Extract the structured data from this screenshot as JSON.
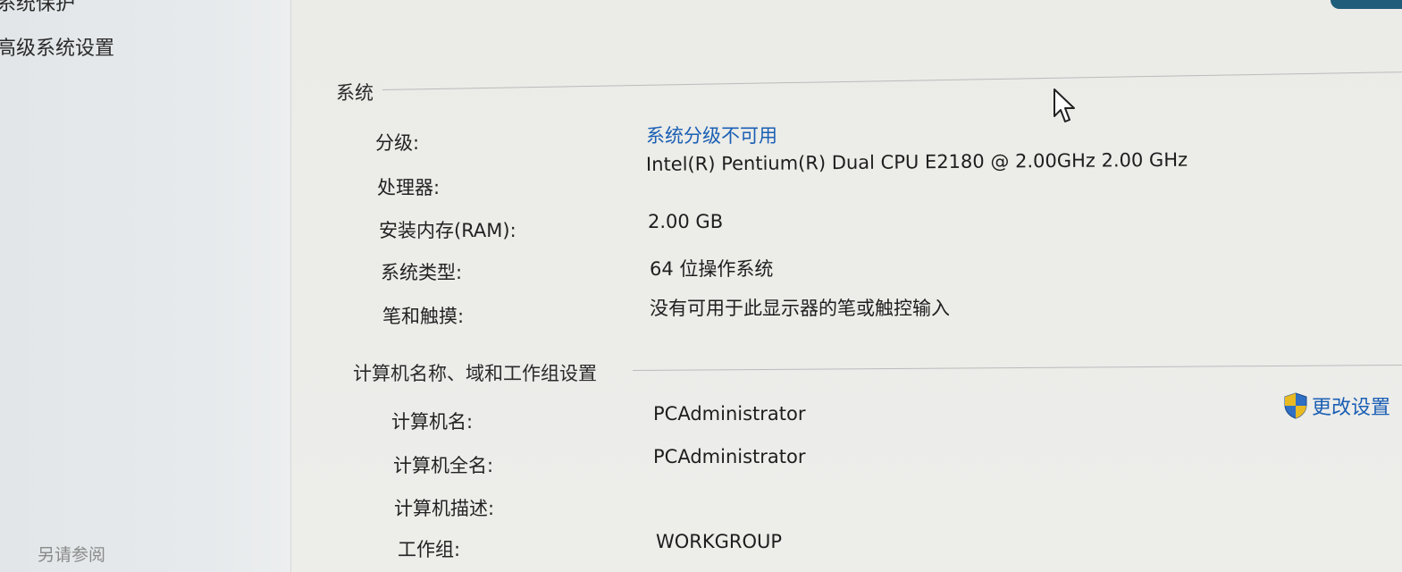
{
  "sidebar": {
    "top_link": "系统保护",
    "advanced_link": "高级系统设置",
    "see_also": "另请参阅"
  },
  "system": {
    "title": "系统",
    "rows": [
      {
        "label": "分级:",
        "value": "系统分级不可用",
        "is_link": true
      },
      {
        "label": "处理器:",
        "value": "Intel(R) Pentium(R) Dual  CPU  E2180  @ 2.00GHz   2.00 GHz",
        "is_link": false
      },
      {
        "label": "安装内存(RAM):",
        "value": "2.00 GB",
        "is_link": false
      },
      {
        "label": "系统类型:",
        "value": "64 位操作系统",
        "is_link": false
      },
      {
        "label": "笔和触摸:",
        "value": "没有可用于此显示器的笔或触控输入",
        "is_link": false
      }
    ]
  },
  "computer": {
    "title": "计算机名称、域和工作组设置",
    "change_settings": "更改设置",
    "rows": [
      {
        "label": "计算机名:",
        "value": "PCAdministrator"
      },
      {
        "label": "计算机全名:",
        "value": "PCAdministrator"
      },
      {
        "label": "计算机描述:",
        "value": ""
      },
      {
        "label": "工作组:",
        "value": "WORKGROUP"
      }
    ]
  },
  "colors": {
    "link": "#1a5fb4",
    "shield_blue": "#2f6fc4",
    "shield_yellow": "#e8b923"
  },
  "icons": {
    "shield": "uac-shield-icon",
    "cursor": "mouse-pointer-icon"
  }
}
